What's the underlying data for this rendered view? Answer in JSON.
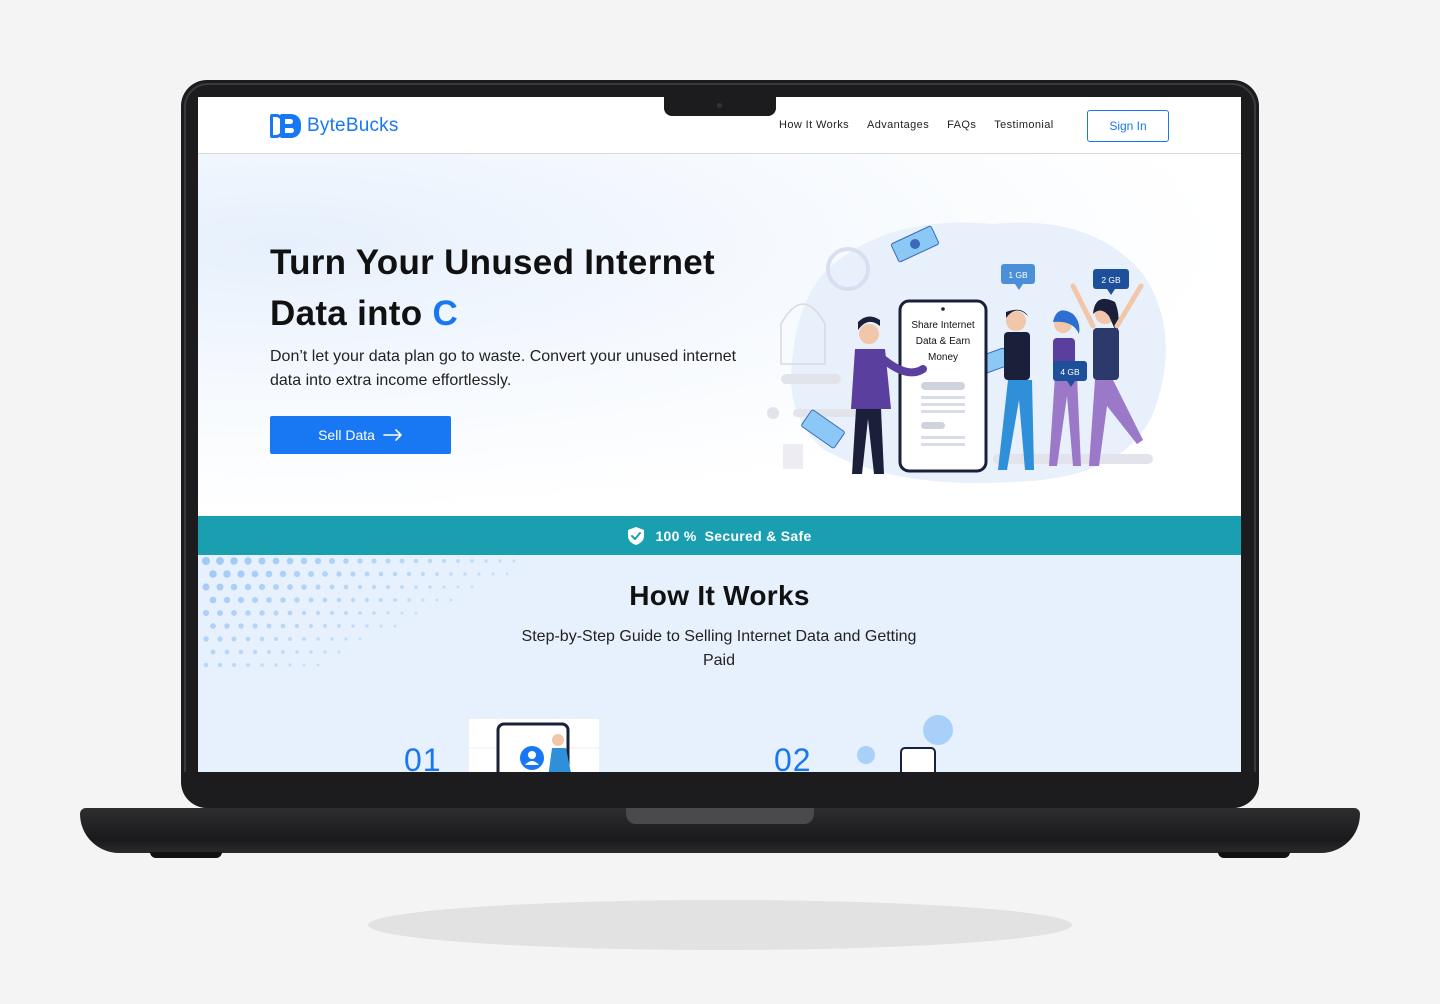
{
  "brand": {
    "name": "ByteBucks",
    "accent": "#1877f2",
    "band_color": "#1a9fb1"
  },
  "nav": {
    "items": [
      "How It Works",
      "Advantages",
      "FAQs",
      "Testimonial"
    ],
    "signin_label": "Sign In"
  },
  "hero": {
    "title_line1": "Turn Your Unused Internet",
    "title_line2_prefix": "Data into ",
    "title_line2_accent": "C",
    "subtitle": "Don’t let your data plan go to waste. Convert your unused internet data into extra income effortlessly.",
    "cta_label": "Sell Data",
    "cta_icon": "arrow-right-icon"
  },
  "illustration": {
    "phone_text": [
      "Share Internet",
      "Data & Earn",
      "Money"
    ],
    "bubbles": [
      "1 GB",
      "2 GB",
      "4 GB"
    ]
  },
  "secure_band": {
    "icon": "shield-check-icon",
    "value": "100 %",
    "text": "Secured & Safe"
  },
  "how_it_works": {
    "title": "How It Works",
    "subtitle": "Step-by-Step Guide to Selling Internet Data and Getting Paid",
    "steps": [
      "01",
      "02"
    ]
  }
}
